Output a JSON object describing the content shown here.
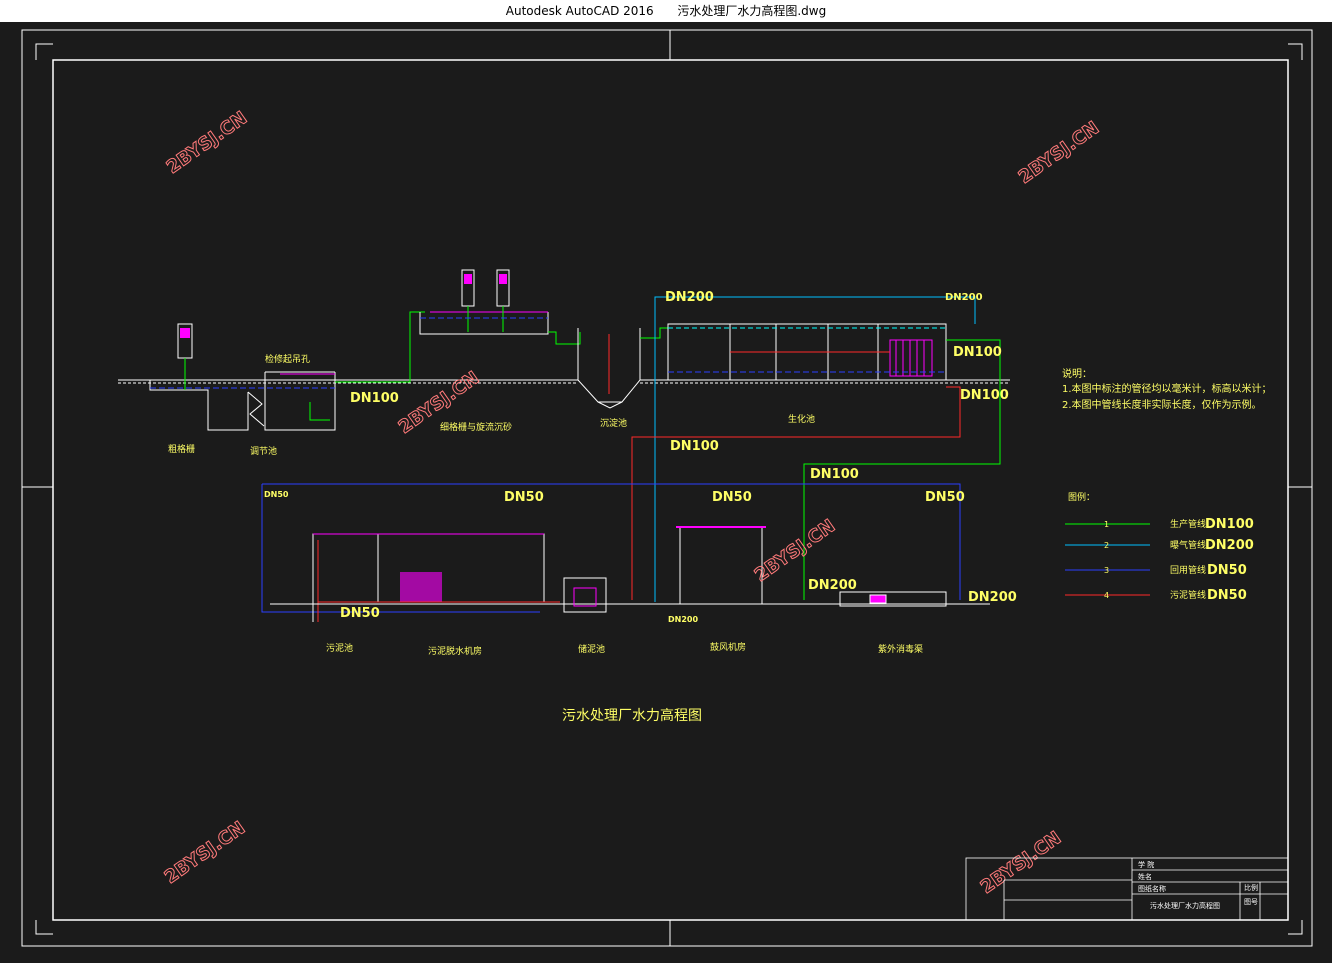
{
  "window": {
    "title_app": "Autodesk AutoCAD 2016",
    "title_file": "污水处理厂水力高程图.dwg"
  },
  "colors": {
    "background": "#1b1b1b",
    "frame": "#ffffff",
    "production_pipe": "#00ff00",
    "air_pipe": "#00bfff",
    "return_pipe": "#2b3fff",
    "sludge_pipe": "#ff2a2a",
    "dn_text": "#ffff66",
    "watermark": "#ff7a7a",
    "level": "#00ffff",
    "structure": "#ffffff",
    "equipment": "#ff00ff"
  },
  "drawing": {
    "title": "污水处理厂水力高程图",
    "upper_labels": {
      "coarse_screen": "粗格栅",
      "regulating_tank": "调节池",
      "fine_screen": "细格栅与旋流沉砂",
      "settling_tank": "沉淀池",
      "biochem_tank": "生化池",
      "overflow_note": "检修起吊孔"
    },
    "lower_labels": {
      "sludge_tank": "污泥池",
      "dewatering_room": "污泥脱水机房",
      "storage_tank": "储泥池",
      "blower_room": "鼓风机房",
      "uv_disinfection": "紫外消毒渠"
    },
    "dn_labels": {
      "dn200_top": "DN200",
      "dn200_top_right": "DN200",
      "dn100_right1": "DN100",
      "dn100_right2": "DN100",
      "dn100_left": "DN100",
      "dn100_mid1": "DN100",
      "dn100_mid2": "DN100",
      "dn50_a": "DN50",
      "dn50_b": "DN50",
      "dn50_c": "DN50",
      "dn50_low": "DN50",
      "dn50_small": "DN50",
      "dn200_low": "DN200",
      "dn200_right": "DN200",
      "dn200_bottom": "DN200"
    },
    "notes": {
      "heading": "说明：",
      "items": [
        "1.本图中标注的管径均以毫米计，标高以米计；",
        "2.本图中管线长度非实际长度，仅作为示例。"
      ]
    },
    "legend": {
      "heading": "图例：",
      "items": [
        {
          "num": "1",
          "name": "生产管线",
          "dn": "DN100",
          "color": "#00ff00"
        },
        {
          "num": "2",
          "name": "曝气管线",
          "dn": "DN200",
          "color": "#00bfff"
        },
        {
          "num": "3",
          "name": "回用管线",
          "dn": "DN50",
          "color": "#2b3fff"
        },
        {
          "num": "4",
          "name": "污泥管线",
          "dn": "DN50",
          "color": "#ff2a2a"
        }
      ]
    },
    "watermark": "2BYSJ.CN",
    "title_block": {
      "school": "学 院",
      "name": "姓名",
      "drawing_name": "图纸名称",
      "project": "污水处理厂水力高程图",
      "scale": "比例",
      "sheet": "图号"
    }
  }
}
